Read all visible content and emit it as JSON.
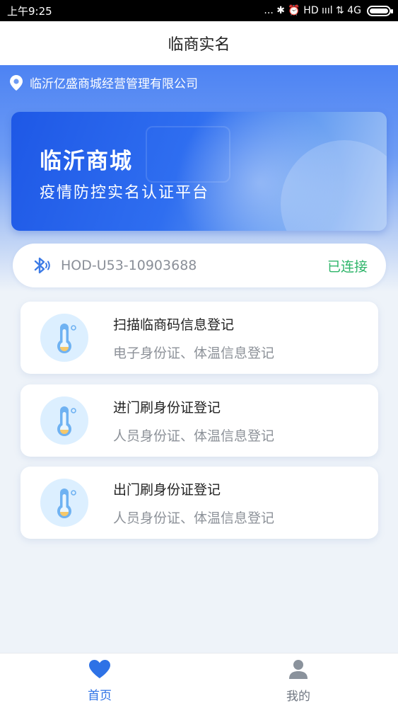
{
  "status_bar": {
    "time": "上午9:25",
    "indicators": "... ✱ ⏰ HD ıııl ⇅ 4G",
    "network": "4G",
    "battery_level": 1.0
  },
  "app_title": "临商实名",
  "company": {
    "icon": "location-pin-icon",
    "name": "临沂亿盛商城经营管理有限公司"
  },
  "banner": {
    "title": "临沂商城",
    "subtitle": "疫情防控实名认证平台"
  },
  "bluetooth": {
    "icon": "bluetooth-icon",
    "device": "HOD-U53-10903688",
    "status": "已连接",
    "status_color": "#2fb56a"
  },
  "cards": [
    {
      "icon": "thermometer-icon",
      "title": "扫描临商码信息登记",
      "subtitle": "电子身份证、体温信息登记"
    },
    {
      "icon": "thermometer-icon",
      "title": "进门刷身份证登记",
      "subtitle": "人员身份证、体温信息登记"
    },
    {
      "icon": "thermometer-icon",
      "title": "出门刷身份证登记",
      "subtitle": "人员身份证、体温信息登记"
    }
  ],
  "bottom_nav": {
    "home": {
      "icon": "heart-icon",
      "label": "首页",
      "active": true
    },
    "mine": {
      "icon": "person-icon",
      "label": "我的",
      "active": false
    }
  },
  "colors": {
    "accent": "#2e72e6",
    "connected": "#2fb56a"
  }
}
